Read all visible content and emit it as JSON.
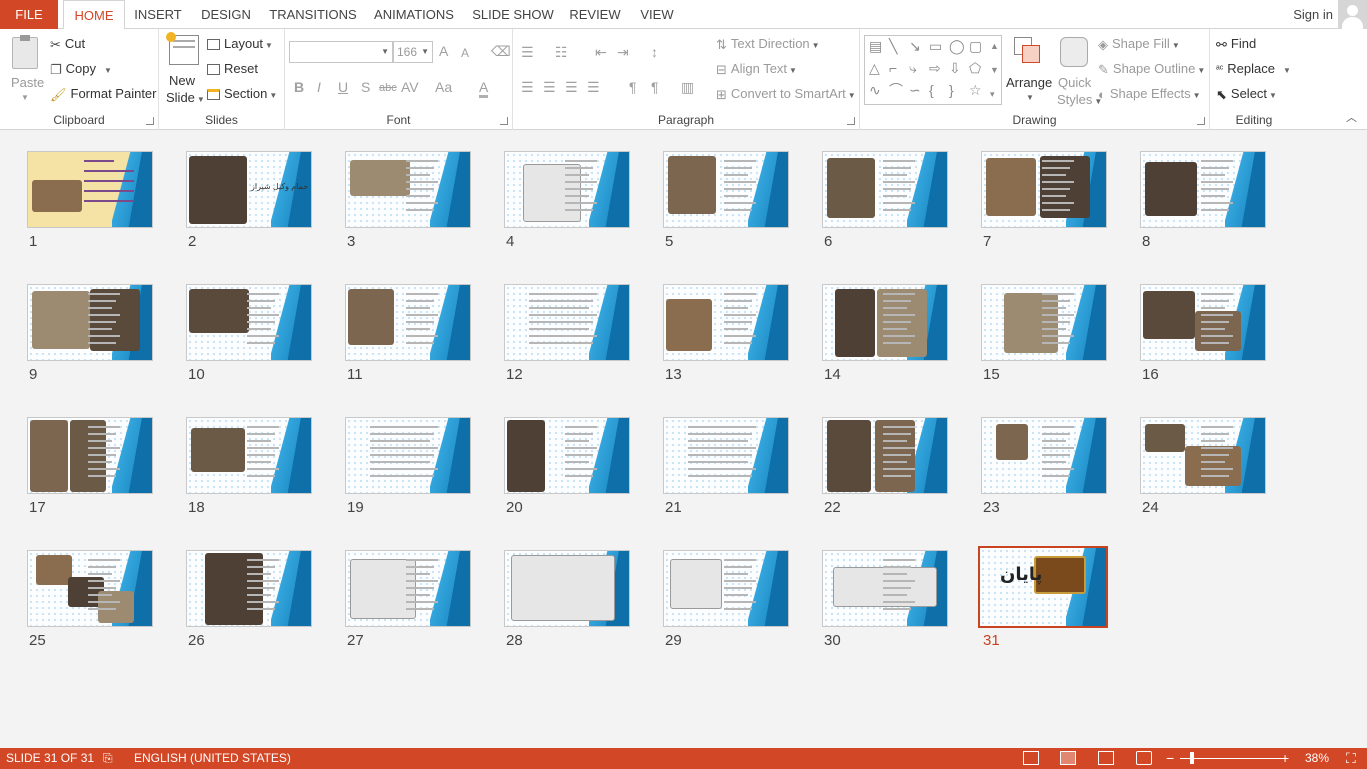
{
  "tabs": {
    "file": "FILE",
    "home": "HOME",
    "insert": "INSERT",
    "design": "DESIGN",
    "transitions": "TRANSITIONS",
    "animations": "ANIMATIONS",
    "slide_show": "SLIDE SHOW",
    "review": "REVIEW",
    "view": "VIEW"
  },
  "account": {
    "sign_in": "Sign in"
  },
  "clipboard": {
    "paste": "Paste",
    "cut": "Cut",
    "copy": "Copy",
    "format_painter": "Format Painter",
    "label": "Clipboard"
  },
  "slides_group": {
    "new_slide": "New",
    "new_slide_2": "Slide",
    "layout": "Layout",
    "reset": "Reset",
    "section": "Section",
    "label": "Slides"
  },
  "font": {
    "font_name": "",
    "font_size": "166",
    "bold": "B",
    "italic": "I",
    "underline": "U",
    "shadow": "S",
    "strike": "abc",
    "spacing": "AV",
    "case": "Aa",
    "color": "A",
    "grow": "A",
    "shrink": "A",
    "label": "Font"
  },
  "paragraph": {
    "text_direction": "Text Direction",
    "align_text": "Align Text",
    "convert_smartart": "Convert to SmartArt",
    "label": "Paragraph"
  },
  "drawing": {
    "arrange": "Arrange",
    "quick_styles": "Quick",
    "quick_styles_2": "Styles",
    "shape_fill": "Shape Fill",
    "shape_outline": "Shape Outline",
    "shape_effects": "Shape Effects",
    "label": "Drawing"
  },
  "editing": {
    "find": "Find",
    "replace": "Replace",
    "select": "Select",
    "label": "Editing"
  },
  "slides": [
    {
      "num": "1"
    },
    {
      "num": "2"
    },
    {
      "num": "3"
    },
    {
      "num": "4"
    },
    {
      "num": "5"
    },
    {
      "num": "6"
    },
    {
      "num": "7"
    },
    {
      "num": "8"
    },
    {
      "num": "9"
    },
    {
      "num": "10"
    },
    {
      "num": "11"
    },
    {
      "num": "12"
    },
    {
      "num": "13"
    },
    {
      "num": "14"
    },
    {
      "num": "15"
    },
    {
      "num": "16"
    },
    {
      "num": "17"
    },
    {
      "num": "18"
    },
    {
      "num": "19"
    },
    {
      "num": "20"
    },
    {
      "num": "21"
    },
    {
      "num": "22"
    },
    {
      "num": "23"
    },
    {
      "num": "24"
    },
    {
      "num": "25"
    },
    {
      "num": "26"
    },
    {
      "num": "27"
    },
    {
      "num": "28"
    },
    {
      "num": "29"
    },
    {
      "num": "30"
    },
    {
      "num": "31"
    }
  ],
  "slide_text": {
    "slide2": "حمام وکیل شیراز",
    "slide31": "پایان"
  },
  "selected_slide": "31",
  "status": {
    "slide_info": "SLIDE 31 OF 31",
    "language": "ENGLISH (UNITED STATES)",
    "zoom": "38%"
  },
  "colors": {
    "accent": "#d24726",
    "selection": "#c8431f",
    "wave": "#1e8cc8"
  }
}
